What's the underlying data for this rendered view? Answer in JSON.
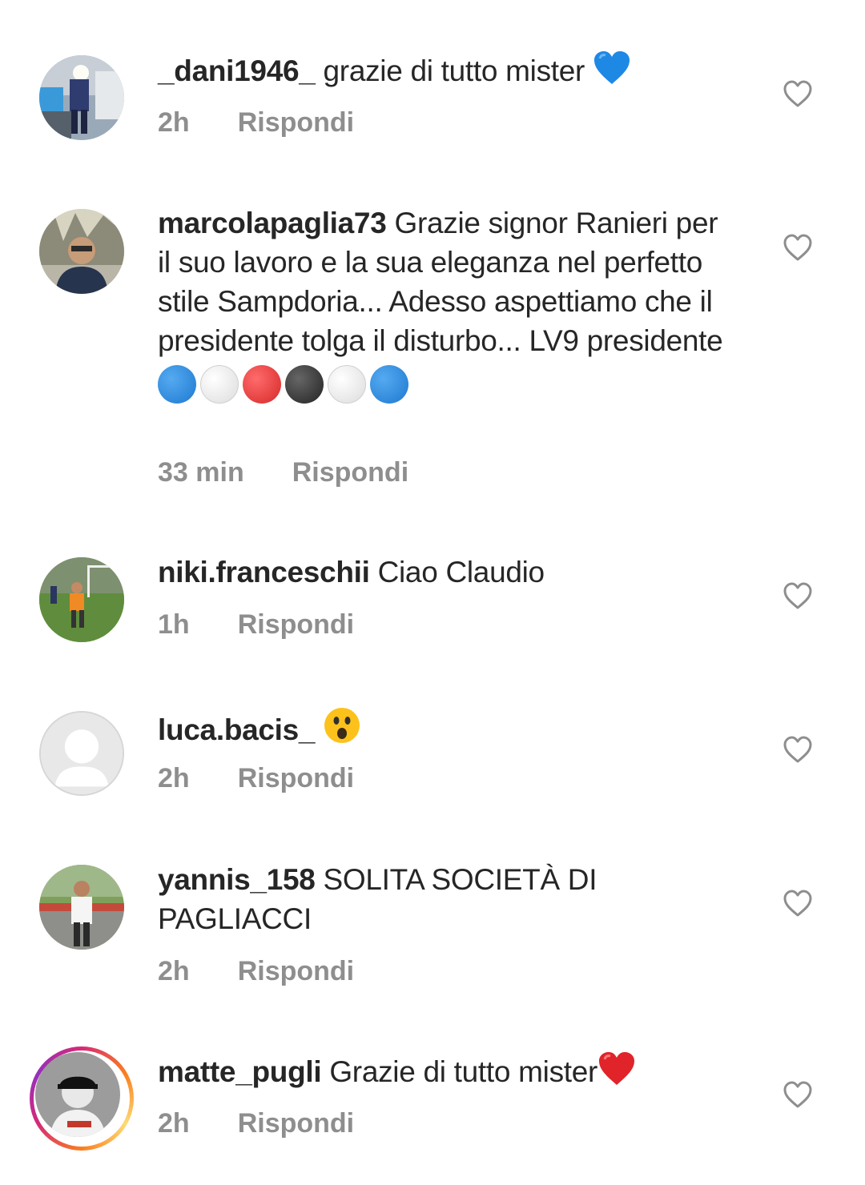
{
  "comments": [
    {
      "username": "_dani1946_",
      "text": "grazie di tutto mister",
      "time": "2h",
      "reply": "Rispondi"
    },
    {
      "username": "marcolapaglia73",
      "text": "Grazie signor Ranieri per il suo lavoro e la sua eleganza nel perfetto stile Sampdoria... Adesso aspettiamo che il presidente tolga il disturbo... LV9 presidente",
      "time": "33 min",
      "reply": "Rispondi"
    },
    {
      "username": "niki.franceschii",
      "text": "Ciao Claudio",
      "time": "1h",
      "reply": "Rispondi"
    },
    {
      "username": "luca.bacis_",
      "text": "",
      "time": "2h",
      "reply": "Rispondi"
    },
    {
      "username": "yannis_158",
      "text": "SOLITA SOCIETÀ DI PAGLIACCI",
      "time": "2h",
      "reply": "Rispondi"
    },
    {
      "username": "matte_pugli",
      "text": "Grazie di tutto mister",
      "time": "2h",
      "reply": "Rispondi"
    }
  ],
  "emoji": {
    "c0": "blue-heart",
    "c1": [
      "blue-circle",
      "white-circle",
      "red-circle",
      "black-circle",
      "white-circle",
      "blue-circle"
    ],
    "c3": "surprised-face",
    "c5": "red-heart"
  },
  "colors": {
    "meta": "#8e8e8e",
    "text": "#262626",
    "like_icon": "#8e8e8e"
  }
}
